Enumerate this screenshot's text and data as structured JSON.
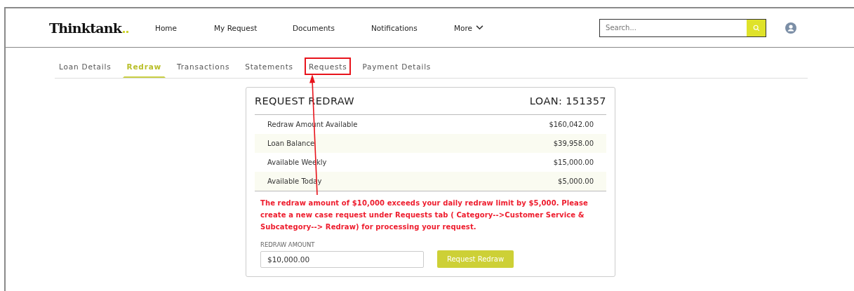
{
  "header": {
    "logo": "Thinktank",
    "nav": [
      {
        "label": "Home",
        "kind": "link"
      },
      {
        "label": "My Request",
        "kind": "link"
      },
      {
        "label": "Documents",
        "kind": "link"
      },
      {
        "label": "Notifications",
        "kind": "link"
      },
      {
        "label": "More",
        "kind": "dropdown"
      }
    ],
    "search": {
      "placeholder": "Search..."
    }
  },
  "tabs": [
    {
      "label": "Loan Details",
      "selected": false,
      "annotated": false
    },
    {
      "label": "Redraw",
      "selected": true,
      "annotated": false
    },
    {
      "label": "Transactions",
      "selected": false,
      "annotated": false
    },
    {
      "label": "Statements",
      "selected": false,
      "annotated": false
    },
    {
      "label": "Requests",
      "selected": false,
      "annotated": true
    },
    {
      "label": "Payment Details",
      "selected": false,
      "annotated": false
    }
  ],
  "card": {
    "title": "REQUEST REDRAW",
    "loan": "LOAN: 151357",
    "rows": [
      {
        "label": "Redraw Amount Available",
        "value": "$160,042.00"
      },
      {
        "label": "Loan Balance",
        "value": "$39,958.00"
      },
      {
        "label": "Available Weekly",
        "value": "$15,000.00"
      },
      {
        "label": "Available Today",
        "value": "$5,000.00"
      }
    ],
    "error": "The redraw amount of $10,000 exceeds your daily redraw limit by $5,000. Please create a new case request under Requests tab ( Category-->Customer Service & Subcategory--> Redraw) for processing your request.",
    "amount_label": "REDRAW AMOUNT",
    "amount_value": "$10,000.00",
    "button": "Request Redraw"
  }
}
